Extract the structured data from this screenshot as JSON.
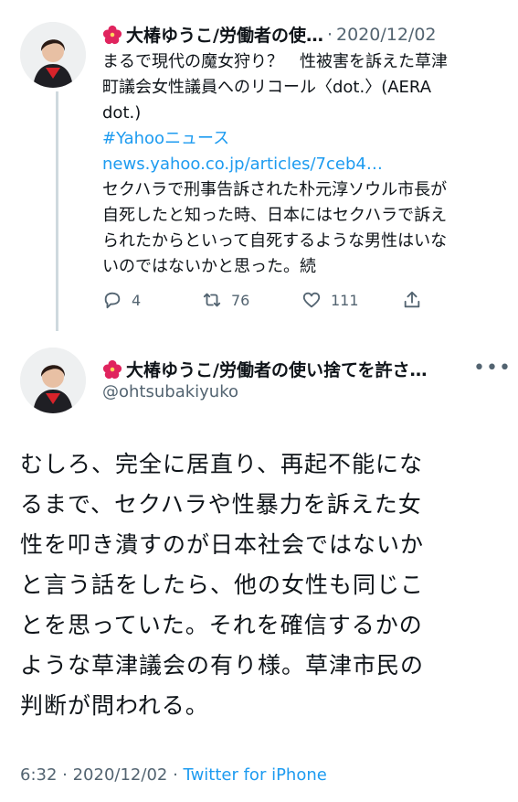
{
  "tweet1": {
    "author_name": "大椿ゆうこ/労働者の使…",
    "date": "2020/12/02",
    "headline_line1": "まるで現代の魔女狩り？　性被害を訴えた草津",
    "headline_line2": "町議会女性議員へのリコール〈dot.〉(AERA",
    "headline_line3": "dot.)",
    "hashtag": "#Yahooニュース",
    "url": "news.yahoo.co.jp/articles/7ceb4…",
    "body_line1": "セクハラで刑事告訴された朴元淳ソウル市長が",
    "body_line2": "自死したと知った時、日本にはセクハラで訴え",
    "body_line3": "られたからといって自死するような男性はいな",
    "body_line4": "いのではないかと思った。続",
    "replies": "4",
    "retweets": "76",
    "likes": "111"
  },
  "tweet2": {
    "author_name": "大椿ゆうこ/労働者の使い捨てを許さ…",
    "handle": "@ohtsubakiyuko",
    "more_label": "•••",
    "body_line1": "むしろ、完全に居直り、再起不能にな",
    "body_line2": "るまで、セクハラや性暴力を訴えた女",
    "body_line3": "性を叩き潰すのが日本社会ではないか",
    "body_line4": "と言う話をしたら、他の女性も同じこ",
    "body_line5": "とを思っていた。それを確信するかの",
    "body_line6": "ような草津議会の有り様。草津市民の",
    "body_line7": "判断が問われる。",
    "time": "6:32",
    "date": "2020/12/02",
    "source": "Twitter for iPhone"
  },
  "colors": {
    "link": "#1d9bf0",
    "secondary_text": "#536471",
    "thread_line": "#cfd9de",
    "flower": "#e0245e"
  },
  "icons": [
    "hibiscus-icon",
    "reply-icon",
    "retweet-icon",
    "like-icon",
    "share-icon"
  ]
}
